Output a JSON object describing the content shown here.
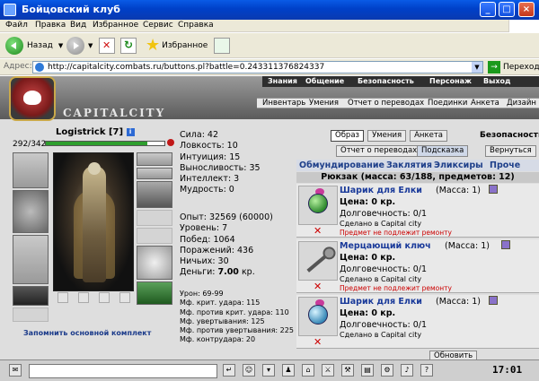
{
  "window": {
    "title": "Бойцовский клуб"
  },
  "menu": [
    "Файл",
    "Правка",
    "Вид",
    "Избранное",
    "Сервис",
    "Справка"
  ],
  "toolbar": {
    "back_label": "Назад",
    "favorites_label": "Избранное"
  },
  "address": {
    "label": "Адрес:",
    "url": "http://capitalcity.combats.ru/buttons.pl?battle=0.243311376824337",
    "go_label": "Переход"
  },
  "site": {
    "logo": "CAPITALCITY",
    "nav_top": [
      "Знания",
      "Общение",
      "Безопасность",
      "Персонаж",
      "Выход"
    ],
    "nav_sub": [
      "Инвентарь",
      "Умения",
      "Отчет о переводах",
      "Поединки",
      "Анкета",
      "Дизайн"
    ]
  },
  "character": {
    "name": "Logistrick",
    "level": "[7]",
    "info_icon_label": "i",
    "hp_text": "292/342",
    "hp_fraction": 0.854,
    "remember_label": "Запомнить основной комплект"
  },
  "stats": {
    "primary": [
      "Сила: 42",
      "Ловкость: 10",
      "Интуиция: 15",
      "Выносливость: 35",
      "Интеллект: 3",
      "Мудрость: 0"
    ],
    "exp": "Опыт: 32569 (60000)",
    "level": "Уровень: 7",
    "wins": "Побед: 1064",
    "losses": "Поражений: 436",
    "draws": "Ничьих: 30",
    "money_label": "Деньги: ",
    "money_value": "7.00",
    "money_unit": " кр.",
    "combat": [
      "Урон: 69-99",
      "Мф. крит. удара: 115",
      "Мф. против крит. удара: 110",
      "Мф. увертывания: 125",
      "Мф. против увертывания: 225",
      "Мф. контрудара: 20"
    ]
  },
  "tabs": {
    "top": [
      "Образ",
      "Умения",
      "Анкета"
    ],
    "security": "Безопасность",
    "transfers": "Отчет о переводах",
    "hint": "Подсказка",
    "back": "Вернуться"
  },
  "inventory": {
    "categories": [
      "Обмундирование",
      "Заклятия",
      "Эликсиры",
      "Проче"
    ],
    "backpack": "Рюкзак (масса: 63/188, предметов: 12)",
    "items": [
      {
        "name": "Шарик для Елки",
        "mass": "(Масса: 1)",
        "price": "Цена: 0 кр.",
        "durability": "Долговечность: 0/1",
        "made": "Сделано в Capital city",
        "repair": "Предмет не подлежит ремонту"
      },
      {
        "name": "Мерцающий ключ",
        "mass": "(Масса: 1)",
        "price": "Цена: 0 кр.",
        "durability": "Долговечность: 0/1",
        "made": "Сделано в Capital city",
        "repair": "Предмет не подлежит ремонту"
      },
      {
        "name": "Шарик для Елки",
        "mass": "(Масса: 1)",
        "price": "Цена: 0 кр.",
        "durability": "Долговечность: 0/1",
        "made": "Сделано в Capital city",
        "repair": ""
      }
    ],
    "delete_glyph": "✕",
    "bottom_button": "Обновить"
  },
  "taskbar": {
    "time": "17:01",
    "small": ""
  },
  "colors": {
    "titlebar": "#0a4fd6",
    "hp": "#2e9e2e",
    "link": "#1a3a9a",
    "warning": "#cc0000"
  }
}
